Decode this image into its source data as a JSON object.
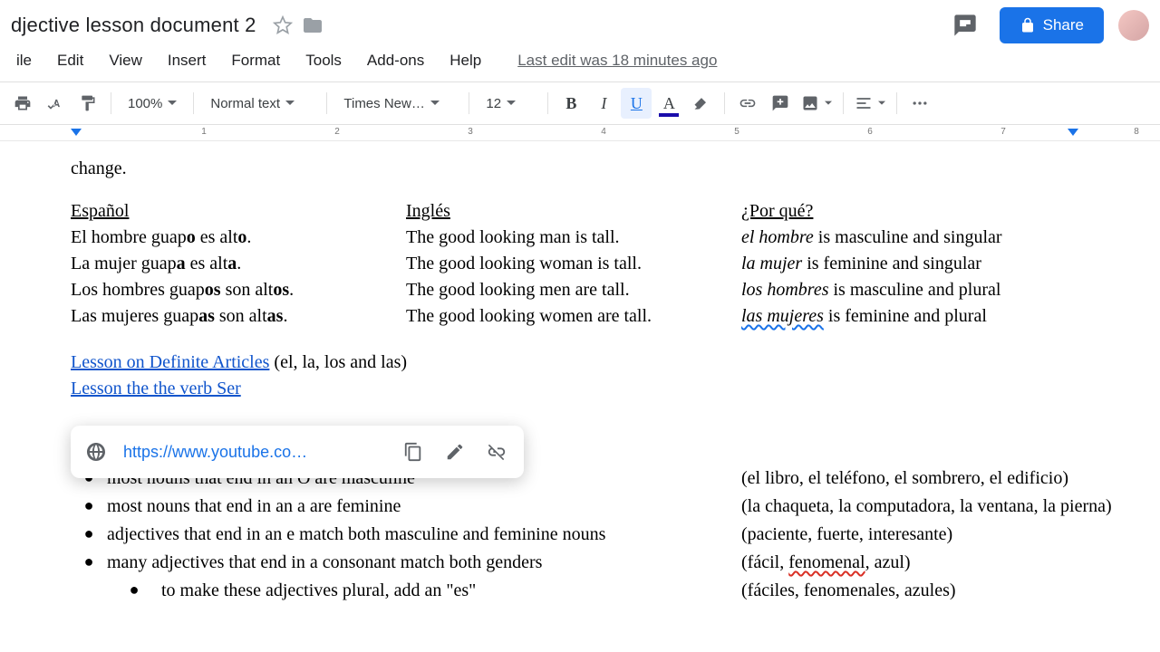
{
  "header": {
    "title": "djective lesson document 2",
    "share": "Share",
    "menus": [
      "ile",
      "Edit",
      "View",
      "Insert",
      "Format",
      "Tools",
      "Add-ons",
      "Help"
    ],
    "last_edit": "Last edit was 18 minutes ago"
  },
  "toolbar": {
    "zoom": "100%",
    "style": "Normal text",
    "font": "Times New…",
    "size": "12"
  },
  "ruler": {
    "ticks": [
      "1",
      "2",
      "3",
      "4",
      "5",
      "6",
      "7",
      "8"
    ]
  },
  "doc": {
    "frag": "change.",
    "headers": {
      "es": "Español",
      "en": "Inglés",
      "why": "¿Por qué?"
    },
    "rows": [
      {
        "es_pre": "El hombre guap",
        "es_b1": "o",
        "es_mid": " es alt",
        "es_b2": "o",
        "es_post": ".",
        "en": "The good looking man is tall.",
        "why_i": "el hombre",
        "why_rest": " is masculine and singular"
      },
      {
        "es_pre": "La mujer guap",
        "es_b1": "a",
        "es_mid": " es alt",
        "es_b2": "a",
        "es_post": ".",
        "en": "The good looking woman is tall.",
        "why_i": "la mujer",
        "why_rest": " is feminine and singular"
      },
      {
        "es_pre": "Los hombres guap",
        "es_b1": "os",
        "es_mid": " son alt",
        "es_b2": "os",
        "es_post": ".",
        "en": "The good looking men are tall.",
        "why_i": "los hombres",
        "why_rest": " is masculine and plural"
      },
      {
        "es_pre": "Las mujeres guap",
        "es_b1": "as",
        "es_mid": " son alt",
        "es_b2": "as",
        "es_post": ".",
        "en": "The good looking women are tall.",
        "why_i": "las mujeres",
        "why_rest": " is feminine and plural",
        "squiggle": true
      }
    ],
    "link1": "Lesson on Definite Articles",
    "link1_after": " (el, la, los and las)",
    "link2": "Lesson the the verb Ser",
    "bullets": [
      {
        "t": "most nouns that end in an O are masculine",
        "p": "(el libro, el teléfono, el sombrero, el edificio)"
      },
      {
        "t": "most nouns that end in an a are feminine",
        "p": "(la chaqueta, la computadora, la ventana, la pierna)"
      },
      {
        "t": "adjectives that end in an e match both masculine and feminine nouns",
        "p": "(paciente, fuerte, interesante)"
      },
      {
        "t": "many adjectives that end in a consonant match both genders",
        "p_pre": "(fácil, ",
        "p_err": "fenomenal",
        "p_post": ", azul)"
      },
      {
        "sub": true,
        "t": "to make these adjectives plural, add an \"es\"",
        "p": "(fáciles, fenomenales, azules)"
      }
    ]
  },
  "popup": {
    "url": "https://www.youtube.co…"
  }
}
